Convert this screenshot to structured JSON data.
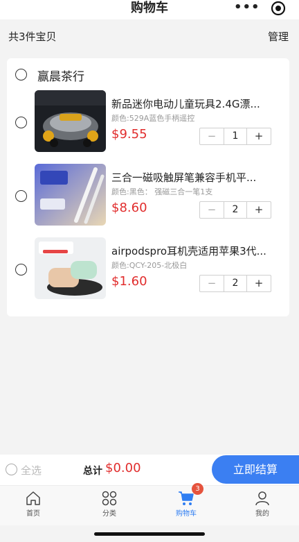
{
  "navbar": {
    "title": "购物车",
    "more_label": "•••"
  },
  "summary": {
    "count_text": "共3件宝贝",
    "manage_label": "管理"
  },
  "shop": {
    "name": "赢晨茶行"
  },
  "items": [
    {
      "title": "新品迷你电动儿童玩具2.4G漂...",
      "spec": "颜色:529A蓝色手柄遥控",
      "price": "$9.55",
      "quantity": "1",
      "minus": "−",
      "plus": "+"
    },
    {
      "title": "三合一磁吸触屏笔兼容手机平...",
      "spec": "颜色:黑色： 强磁三合一笔1支",
      "price": "$8.60",
      "quantity": "2",
      "minus": "−",
      "plus": "+"
    },
    {
      "title": "airpodspro耳机壳适用苹果3代...",
      "spec": "颜色:QCY-205-北极白",
      "price": "$1.60",
      "quantity": "2",
      "minus": "−",
      "plus": "+"
    }
  ],
  "checkout": {
    "select_all_label": "全选",
    "total_label": "总计",
    "total_amount": "$0.00",
    "checkout_label": "立即结算"
  },
  "tabbar": {
    "tabs": [
      {
        "label": "首页",
        "icon": "home-icon"
      },
      {
        "label": "分类",
        "icon": "category-icon"
      },
      {
        "label": "购物车",
        "icon": "cart-icon",
        "badge": "3",
        "active": true
      },
      {
        "label": "我的",
        "icon": "profile-icon"
      }
    ]
  },
  "colors": {
    "accent": "#3b7ff2",
    "price": "#e12d2d",
    "badge": "#e5533d"
  }
}
